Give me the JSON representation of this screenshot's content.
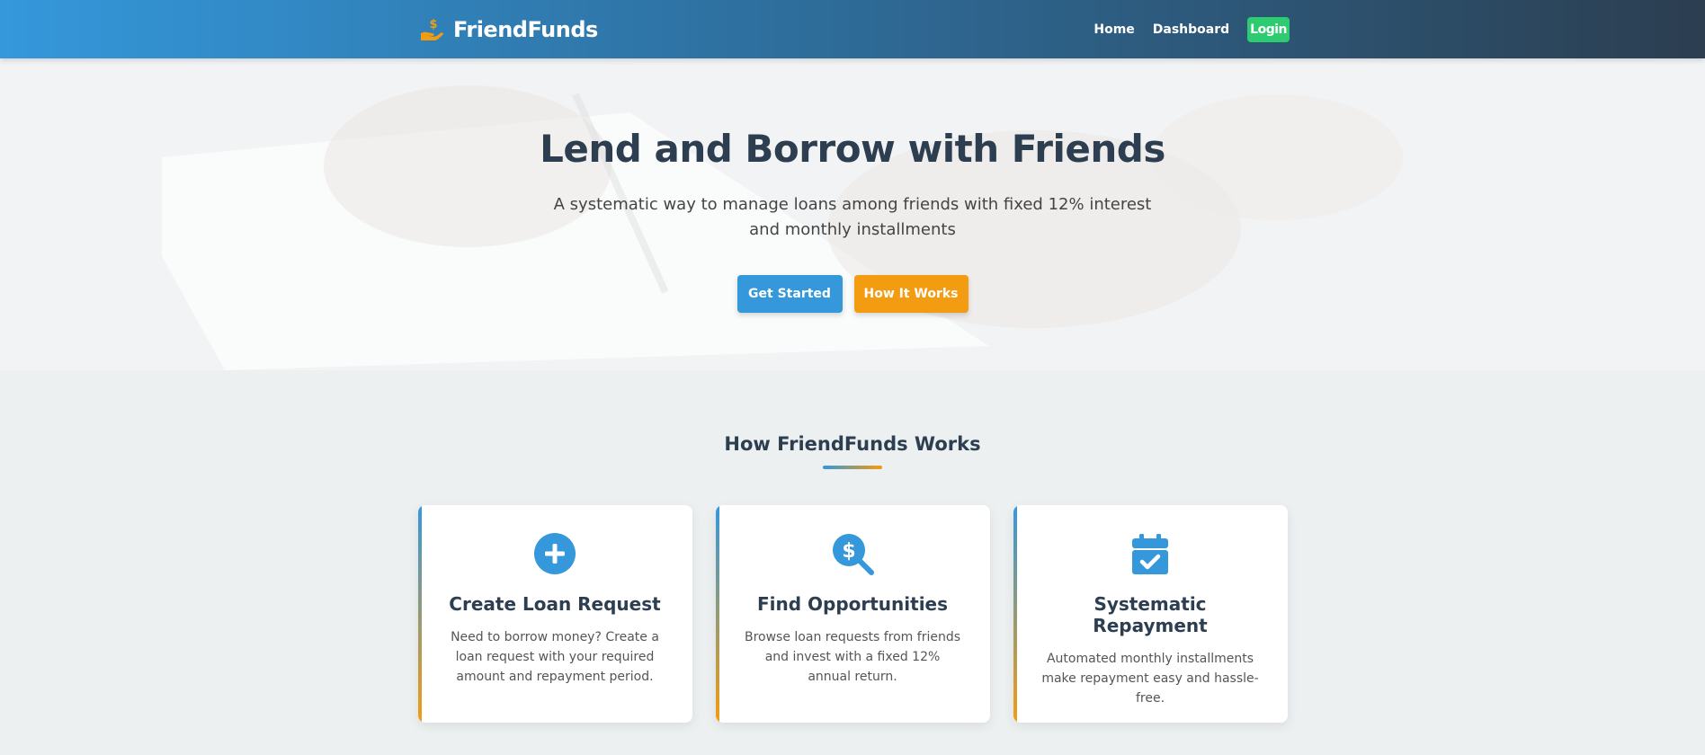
{
  "brand": {
    "name": "FriendFunds",
    "icon": "hand-holding-dollar-icon"
  },
  "nav": {
    "home": "Home",
    "dashboard": "Dashboard",
    "login": "Login"
  },
  "hero": {
    "title": "Lend and Borrow with Friends",
    "subtitle": "A systematic way to manage loans among friends with fixed 12% interest and monthly installments",
    "cta_primary": "Get Started",
    "cta_secondary": "How It Works"
  },
  "features": {
    "title": "How FriendFunds Works",
    "cards": [
      {
        "icon": "plus-circle-icon",
        "title": "Create Loan Request",
        "text": "Need to borrow money? Create a loan request with your required amount and repayment period."
      },
      {
        "icon": "search-dollar-icon",
        "title": "Find Opportunities",
        "text": "Browse loan requests from friends and invest with a fixed 12% annual return."
      },
      {
        "icon": "calendar-check-icon",
        "title": "Systematic Repayment",
        "text": "Automated monthly installments make repayment easy and hassle-free."
      }
    ]
  },
  "colors": {
    "primary": "#3498db",
    "secondary": "#f39c12",
    "success": "#2ecc71",
    "dark": "#2c3e50"
  }
}
